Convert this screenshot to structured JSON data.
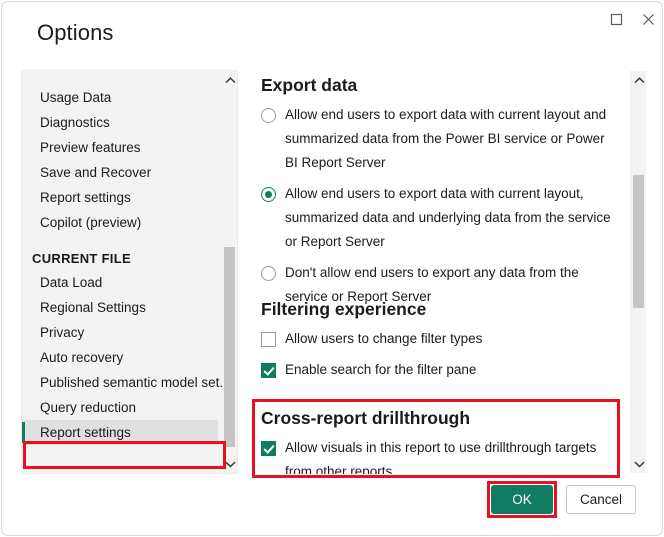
{
  "window": {
    "title": "Options",
    "maximize_icon": "maximize-icon",
    "close_icon": "close-icon"
  },
  "sidebar": {
    "scroll_up_icon": "chevron-up-icon",
    "scroll_down_icon": "chevron-down-icon",
    "items": [
      {
        "label": "Usage Data",
        "type": "item",
        "selected": false
      },
      {
        "label": "Diagnostics",
        "type": "item",
        "selected": false
      },
      {
        "label": "Preview features",
        "type": "item",
        "selected": false
      },
      {
        "label": "Save and Recover",
        "type": "item",
        "selected": false
      },
      {
        "label": "Report settings",
        "type": "item",
        "selected": false
      },
      {
        "label": "Copilot (preview)",
        "type": "item",
        "selected": false
      },
      {
        "label": "CURRENT FILE",
        "type": "group",
        "selected": false
      },
      {
        "label": "Data Load",
        "type": "item",
        "selected": false
      },
      {
        "label": "Regional Settings",
        "type": "item",
        "selected": false
      },
      {
        "label": "Privacy",
        "type": "item",
        "selected": false
      },
      {
        "label": "Auto recovery",
        "type": "item",
        "selected": false
      },
      {
        "label": "Published semantic model set...",
        "type": "item",
        "selected": false
      },
      {
        "label": "Query reduction",
        "type": "item",
        "selected": false
      },
      {
        "label": "Report settings",
        "type": "item",
        "selected": true
      }
    ]
  },
  "content": {
    "scroll_up_icon": "chevron-up-icon",
    "scroll_down_icon": "chevron-down-icon",
    "export": {
      "title": "Export data",
      "options": [
        {
          "label": "Allow end users to export data with current layout and summarized data from the Power BI service or Power BI Report Server",
          "selected": false
        },
        {
          "label": "Allow end users to export data with current layout, summarized data and underlying data from the service or Report Server",
          "selected": true
        },
        {
          "label": "Don't allow end users to export any data from the service or Report Server",
          "selected": false
        }
      ]
    },
    "filtering": {
      "title": "Filtering experience",
      "options": [
        {
          "label": "Allow users to change filter types",
          "checked": false
        },
        {
          "label": "Enable search for the filter pane",
          "checked": true
        }
      ]
    },
    "drillthrough": {
      "title": "Cross-report drillthrough",
      "options": [
        {
          "label": "Allow visuals in this report to use drillthrough targets from other reports",
          "checked": true
        }
      ]
    }
  },
  "footer": {
    "ok_label": "OK",
    "cancel_label": "Cancel"
  },
  "colors": {
    "accent_green": "#107c62",
    "annotation_red": "#e81123",
    "selected_row": "#e0e0e0",
    "sidebar_bg": "#f3f3f3"
  }
}
